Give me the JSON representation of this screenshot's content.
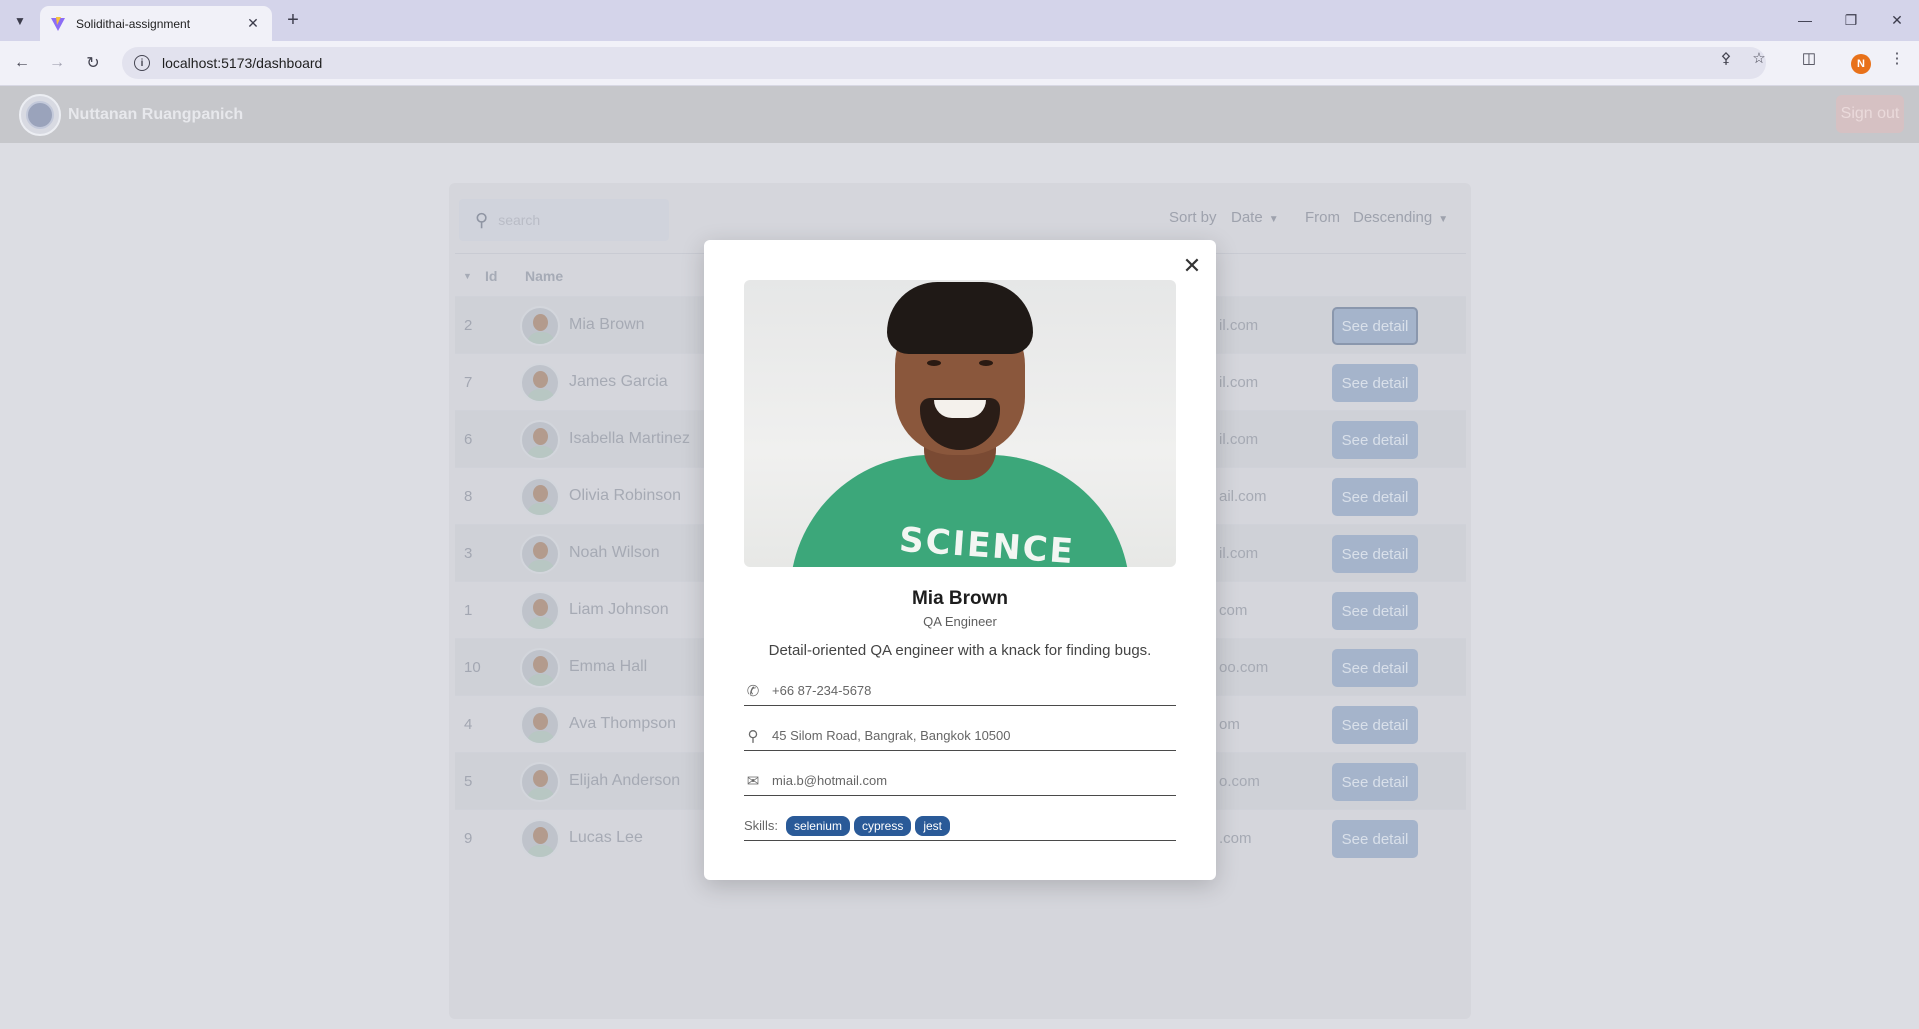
{
  "browser": {
    "tab_title": "Solidithai-assignment",
    "url": "localhost:5173/dashboard",
    "profile_initial": "N"
  },
  "header": {
    "user_name": "Nuttanan Ruangpanich",
    "signout_label": "Sign out"
  },
  "toolbar": {
    "search_placeholder": "search",
    "sort_by_label": "Sort by",
    "sort_by_value": "Date",
    "from_label": "From",
    "from_value": "Descending"
  },
  "table": {
    "headers": {
      "id": "Id",
      "name": "Name"
    },
    "rows": [
      {
        "id": "2",
        "name": "Mia Brown",
        "email_fragment": "il.com",
        "action": "See detail"
      },
      {
        "id": "7",
        "name": "James Garcia",
        "email_fragment": "il.com",
        "action": "See detail"
      },
      {
        "id": "6",
        "name": "Isabella Martinez",
        "email_fragment": "il.com",
        "action": "See detail"
      },
      {
        "id": "8",
        "name": "Olivia Robinson",
        "email_fragment": "ail.com",
        "action": "See detail"
      },
      {
        "id": "3",
        "name": "Noah Wilson",
        "email_fragment": "il.com",
        "action": "See detail"
      },
      {
        "id": "1",
        "name": "Liam Johnson",
        "email_fragment": "com",
        "action": "See detail"
      },
      {
        "id": "10",
        "name": "Emma Hall",
        "email_fragment": "oo.com",
        "action": "See detail"
      },
      {
        "id": "4",
        "name": "Ava Thompson",
        "email_fragment": "om",
        "action": "See detail"
      },
      {
        "id": "5",
        "name": "Elijah Anderson",
        "email_fragment": "o.com",
        "action": "See detail"
      },
      {
        "id": "9",
        "name": "Lucas Lee",
        "email_fragment": ".com",
        "action": "See detail"
      }
    ]
  },
  "modal": {
    "photo_text": "SCIENCE",
    "name": "Mia Brown",
    "role": "QA Engineer",
    "bio": "Detail-oriented QA engineer with a knack for finding bugs.",
    "phone": "+66 87-234-5678",
    "address": "45 Silom Road, Bangrak, Bangkok 10500",
    "email": "mia.b@hotmail.com",
    "skills_label": "Skills:",
    "skills": [
      "selenium",
      "cypress",
      "jest"
    ]
  },
  "colors": {
    "skill_chip": "#2a5a98",
    "shirt": "#3ca77a",
    "profile": "#e8711a"
  }
}
